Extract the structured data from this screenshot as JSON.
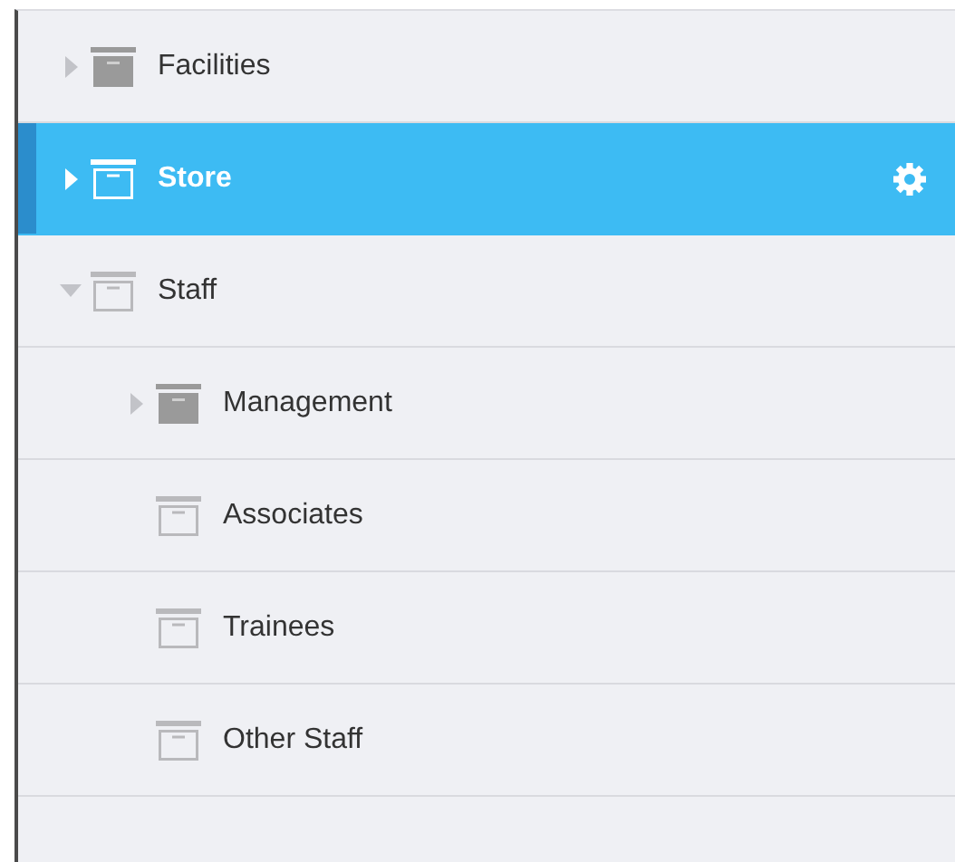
{
  "tree": [
    {
      "label": "Facilities",
      "expanded": false,
      "selected": false
    },
    {
      "label": "Store",
      "expanded": false,
      "selected": true
    },
    {
      "label": "Staff",
      "expanded": true,
      "selected": false,
      "children": [
        {
          "label": "Management",
          "expanded": false,
          "selected": false
        },
        {
          "label": "Associates",
          "selected": false
        },
        {
          "label": "Trainees",
          "selected": false
        },
        {
          "label": "Other Staff",
          "selected": false
        }
      ]
    }
  ]
}
